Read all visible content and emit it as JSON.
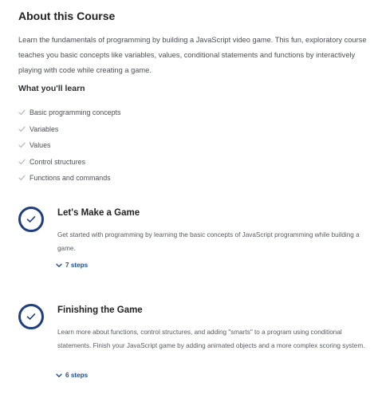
{
  "course": {
    "title": "About this Course",
    "description": "Learn the fundamentals of programming by building a JavaScript video game. This fun, exploratory course teaches you basic concepts like variables, values, conditional statements and functions by interactively playing with code while creating a game.",
    "learn_heading": "What you'll learn",
    "learn_items": [
      "Basic programming concepts",
      "Variables",
      "Values",
      "Control structures",
      "Functions and commands"
    ]
  },
  "modules": [
    {
      "title": "Let's Make a Game",
      "description": "Get started with programming by learning the basic concepts of JavaScript programming while building a game.",
      "steps": "7 steps",
      "icon": "check-circle-icon"
    },
    {
      "title": "Finishing the Game",
      "description": "Learn more about functions, control structures, and adding \"smarts\" to a program using conditional statements. Finish your JavaScript game by adding animated objects and a more complex scoring system.",
      "steps": "6 steps",
      "icon": "check-circle-icon"
    }
  ],
  "colors": {
    "accent": "#1f3f7e",
    "link": "#1f4f96",
    "check": "#b9bcc0"
  }
}
